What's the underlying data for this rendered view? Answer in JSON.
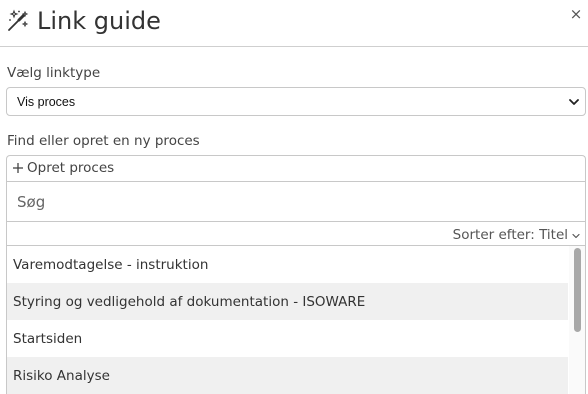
{
  "header": {
    "title": "Link guide",
    "icon": "magic-wand-icon",
    "close_label": "×"
  },
  "link_type": {
    "label": "Vælg linktype",
    "selected": "Vis proces"
  },
  "find": {
    "label": "Find eller opret en ny proces",
    "create_label": "Opret proces",
    "search_placeholder": "Søg",
    "sort_label": "Sorter efter: Titel"
  },
  "results": [
    {
      "title": "Varemodtagelse - instruktion"
    },
    {
      "title": "Styring og vedligehold af dokumentation - ISOWARE"
    },
    {
      "title": "Startsiden"
    },
    {
      "title": "Risiko Analyse"
    }
  ],
  "colors": {
    "text": "#333333",
    "alt_row": "#f0f0f0",
    "border": "#c8c8c8",
    "scroll_thumb": "#a8a8a8"
  }
}
